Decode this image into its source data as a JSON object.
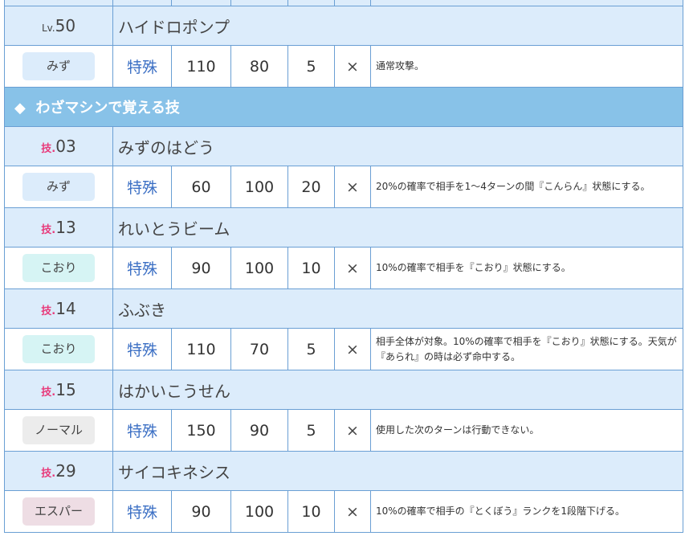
{
  "level_moves": [
    {
      "prefix": "Lv.",
      "number": "50",
      "name": "ハイドロポンプ",
      "type": "みず",
      "type_color": "#dcecfb",
      "category": "特殊",
      "power": "110",
      "accuracy": "80",
      "pp": "5",
      "contact": "×",
      "description": "通常攻撃。"
    }
  ],
  "section": {
    "icon": "◆",
    "title": "わざマシンで覚える技"
  },
  "tm_moves": [
    {
      "prefix": "技.",
      "number": "03",
      "name": "みずのはどう",
      "type": "みず",
      "type_color": "#dcecfb",
      "category": "特殊",
      "power": "60",
      "accuracy": "100",
      "pp": "20",
      "contact": "×",
      "description": "20%の確率で相手を1〜4ターンの間『こんらん』状態にする。"
    },
    {
      "prefix": "技.",
      "number": "13",
      "name": "れいとうビーム",
      "type": "こおり",
      "type_color": "#d6f4f4",
      "category": "特殊",
      "power": "90",
      "accuracy": "100",
      "pp": "10",
      "contact": "×",
      "description": "10%の確率で相手を『こおり』状態にする。"
    },
    {
      "prefix": "技.",
      "number": "14",
      "name": "ふぶき",
      "type": "こおり",
      "type_color": "#d6f4f4",
      "category": "特殊",
      "power": "110",
      "accuracy": "70",
      "pp": "5",
      "contact": "×",
      "description": "相手全体が対象。10%の確率で相手を『こおり』状態にする。天気が『あられ』の時は必ず命中する。"
    },
    {
      "prefix": "技.",
      "number": "15",
      "name": "はかいこうせん",
      "type": "ノーマル",
      "type_color": "#ececec",
      "category": "特殊",
      "power": "150",
      "accuracy": "90",
      "pp": "5",
      "contact": "×",
      "description": "使用した次のターンは行動できない。"
    },
    {
      "prefix": "技.",
      "number": "29",
      "name": "サイコキネシス",
      "type": "エスパー",
      "type_color": "#eedde4",
      "category": "特殊",
      "power": "90",
      "accuracy": "100",
      "pp": "10",
      "contact": "×",
      "description": "10%の確率で相手の『とくぼう』ランクを1段階下げる。"
    }
  ]
}
